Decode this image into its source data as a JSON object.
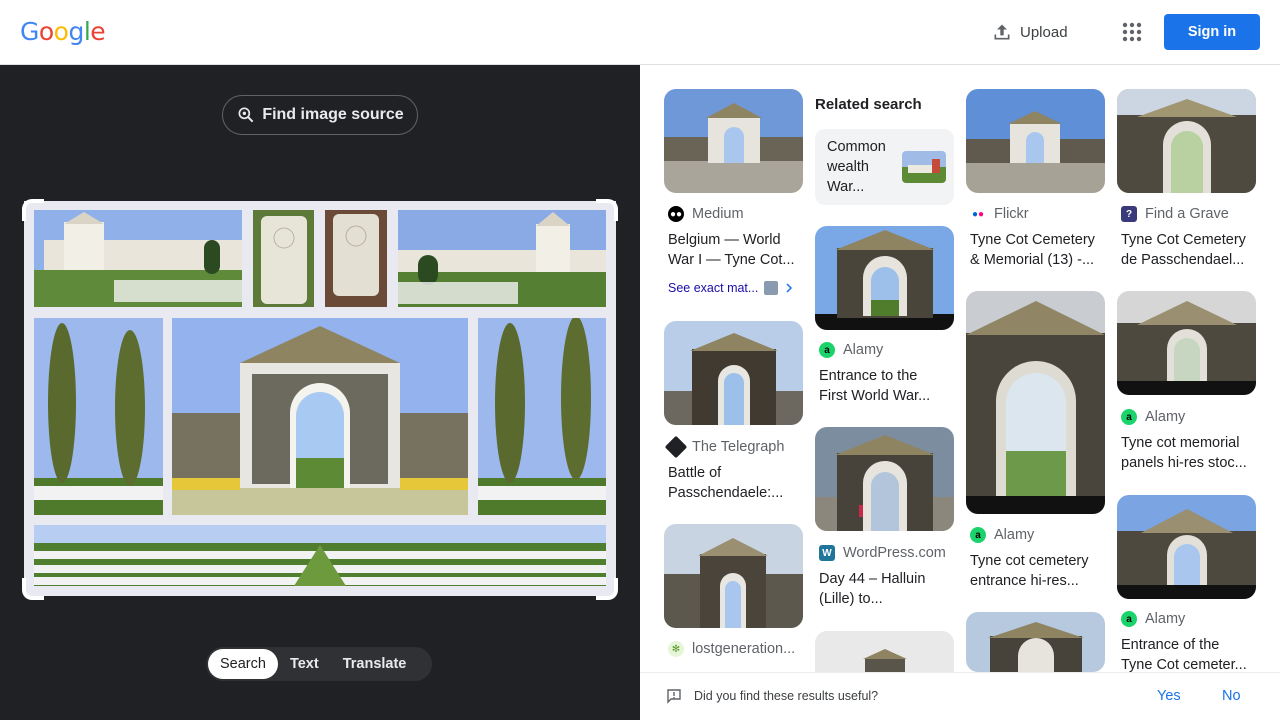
{
  "header": {
    "logo_letters": [
      {
        "ch": "G",
        "color": "#4285F4"
      },
      {
        "ch": "o",
        "color": "#EA4335"
      },
      {
        "ch": "o",
        "color": "#FBBC05"
      },
      {
        "ch": "g",
        "color": "#4285F4"
      },
      {
        "ch": "l",
        "color": "#34A853"
      },
      {
        "ch": "e",
        "color": "#EA4335"
      }
    ],
    "upload_label": "Upload",
    "apps_icon": "apps-grid-icon",
    "signin_label": "Sign in"
  },
  "left": {
    "find_source_label": "Find image source",
    "modes": [
      {
        "label": "Search",
        "active": true
      },
      {
        "label": "Text",
        "active": false
      },
      {
        "label": "Translate",
        "active": false
      }
    ]
  },
  "related": {
    "heading": "Related search",
    "card_text": "Common wealth War..."
  },
  "results": [
    {
      "source": "Medium",
      "title": "Belgium — World War I — Tyne Cot...",
      "see_exact": "See exact mat..."
    },
    {
      "source": "The Telegraph",
      "title": "Battle of Passchendaele:..."
    },
    {
      "source": "lostgeneration..."
    },
    {
      "source": "Alamy",
      "title": "Entrance to the First World War..."
    },
    {
      "source": "WordPress.com",
      "title": "Day 44 – Halluin (Lille) to..."
    },
    {
      "source": "Flickr",
      "title": "Tyne Cot Cemetery & Memorial (13) -..."
    },
    {
      "source": "Alamy",
      "title": "Tyne cot cemetery entrance hi-res..."
    },
    {
      "source": "Find a Grave",
      "title": "Tyne Cot Cemetery de Passchendael..."
    },
    {
      "source": "Alamy",
      "title": "Tyne cot memorial panels hi-res stoc..."
    },
    {
      "source": "Alamy",
      "title": "Entrance of the Tyne Cot cemeter..."
    }
  ],
  "footer": {
    "question": "Did you find these results useful?",
    "yes": "Yes",
    "no": "No"
  },
  "colors": {
    "accent": "#1a73e8",
    "dark_pane": "#202124"
  }
}
